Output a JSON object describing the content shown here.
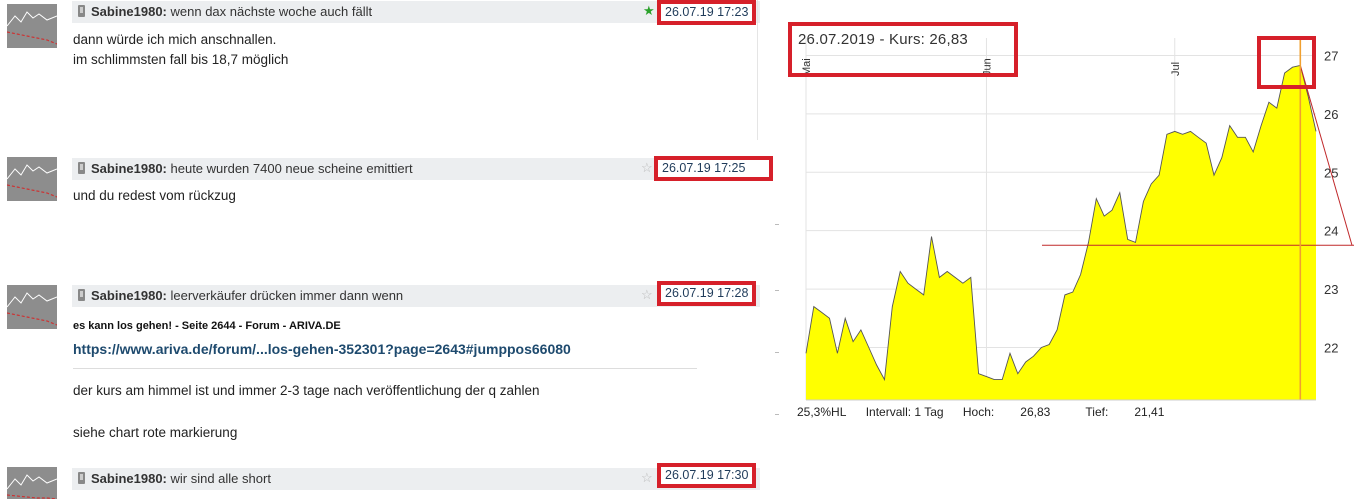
{
  "posts": [
    {
      "user": "Sabine1980:",
      "title": "wenn dax nächste woche auch fällt",
      "time": "26.07.19 17:23",
      "star": "★",
      "lines": [
        "dann würde ich mich anschnallen.",
        "im schlimmsten  fall bis 18,7 möglich"
      ]
    },
    {
      "user": "Sabine1980:",
      "title": "heute wurden 7400 neue scheine emittiert",
      "time": "26.07.19 17:25",
      "star": "☆",
      "lines": [
        "und du redest vom rückzug"
      ]
    },
    {
      "user": "Sabine1980:",
      "title": "leerverkäufer drücken immer dann wenn",
      "time": "26.07.19 17:28",
      "star": "☆",
      "link_title": "es kann los gehen! - Seite 2644 - Forum - ARIVA.DE",
      "link_url": "https://www.ariva.de/forum/...los-gehen-352301?page=2643#jumppos66080",
      "lines": [
        "der kurs am himmel ist und immer 2-3 tage nach veröffentlichung der q zahlen",
        "siehe chart  rote  markierung"
      ]
    },
    {
      "user": "Sabine1980:",
      "title": "wir sind alle short",
      "time": "26.07.19 17:30",
      "star": "☆",
      "lines": []
    }
  ],
  "chart_data": {
    "type": "area",
    "headline": "26.07.2019  -  Kurs: 26,83",
    "month_labels": [
      "Mai",
      "Jun",
      "Jul"
    ],
    "ylabels": [
      "27",
      "26",
      "25",
      "24",
      "23",
      "22"
    ],
    "ylim": [
      21.1,
      27.3
    ],
    "series": [
      {
        "values": [
          21.9,
          22.7,
          22.6,
          22.5,
          21.9,
          22.5,
          22.1,
          22.3,
          22.0,
          21.7,
          21.45,
          22.7,
          23.3,
          23.1,
          23.0,
          22.9,
          23.9,
          23.2,
          23.3,
          23.2,
          23.1,
          23.2,
          21.55,
          21.5,
          21.45,
          21.45,
          21.9,
          21.55,
          21.75,
          21.85,
          22.0,
          22.05,
          22.3,
          22.9,
          22.95,
          23.25,
          23.8,
          24.55,
          24.25,
          24.35,
          24.65,
          23.85,
          23.8,
          24.5,
          24.8,
          24.95,
          25.65,
          25.7,
          25.65,
          25.7,
          25.6,
          25.5,
          24.95,
          25.25,
          25.8,
          25.6,
          25.6,
          25.35,
          25.8,
          26.2,
          26.1,
          26.7,
          26.8,
          26.83,
          26.3,
          25.7
        ]
      }
    ],
    "fill_color": "#ffff00",
    "resistance": 23.75,
    "stats": {
      "hl": "25,3%HL",
      "interval": "Intervall: 1 Tag",
      "hoch_label": "Hoch:",
      "hoch": "26,83",
      "tief_label": "Tief:",
      "tief": "21,41"
    }
  }
}
